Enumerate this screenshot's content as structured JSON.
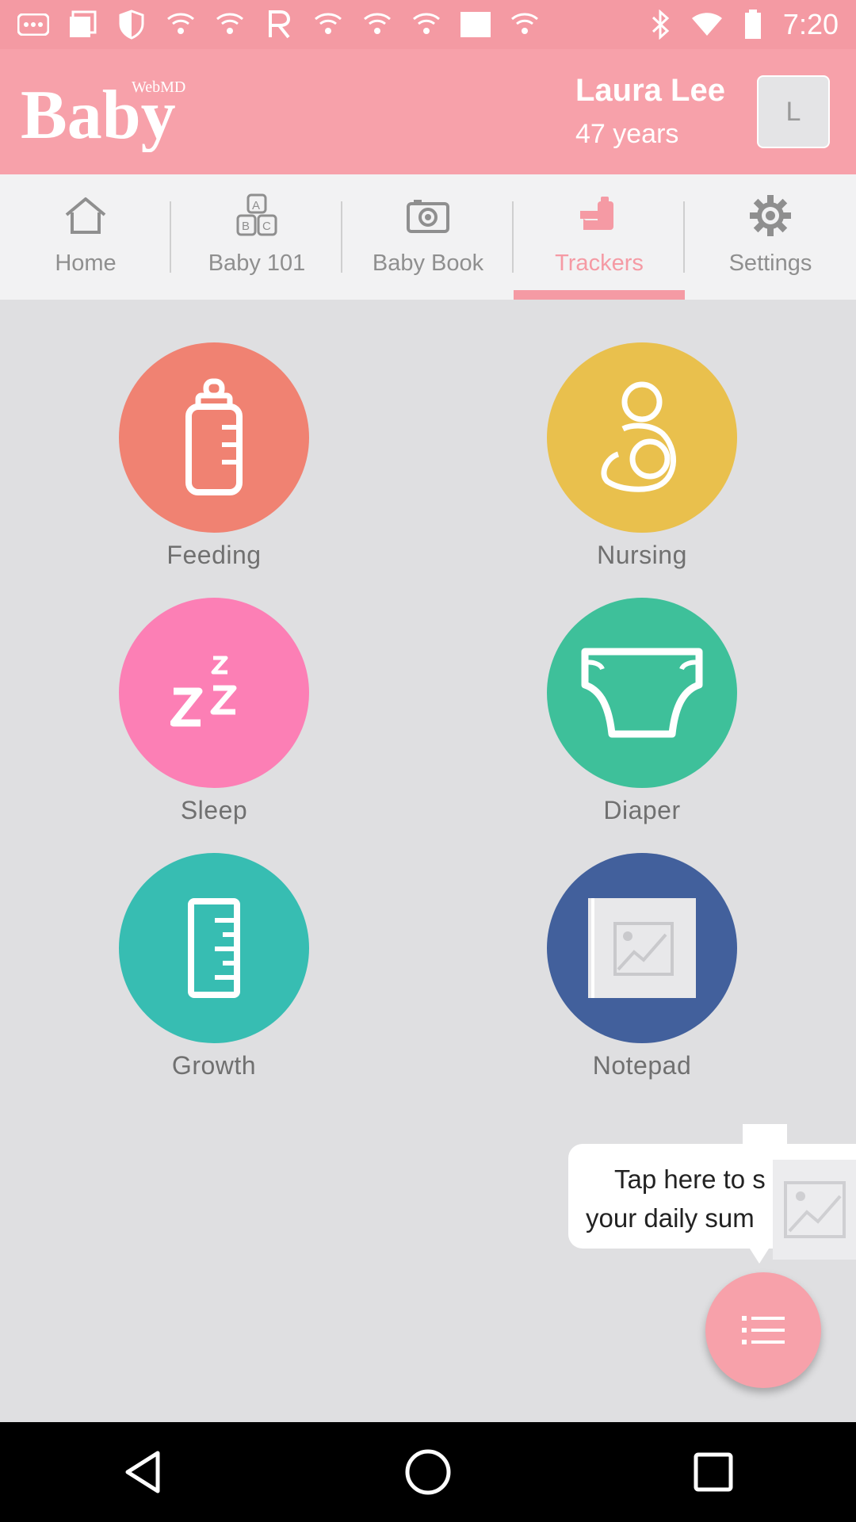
{
  "status_bar": {
    "time": "7:20",
    "icons": [
      "more-icon",
      "gallery-icon",
      "shield-icon",
      "wifi-icon",
      "wifi-icon",
      "app-r-icon",
      "wifi-icon",
      "wifi-icon",
      "wifi-icon",
      "image-icon",
      "wifi-icon",
      "bluetooth-icon",
      "wifi-icon",
      "battery-icon"
    ]
  },
  "header": {
    "logo_main": "Baby",
    "logo_brand": "WebMD",
    "user_name": "Laura Lee",
    "user_age": "47 years",
    "avatar_initial": "L"
  },
  "tabs": [
    {
      "label": "Home",
      "icon": "home-icon"
    },
    {
      "label": "Baby 101",
      "icon": "abc-blocks-icon"
    },
    {
      "label": "Baby Book",
      "icon": "camera-icon"
    },
    {
      "label": "Trackers",
      "icon": "tracker-icon",
      "active": true
    },
    {
      "label": "Settings",
      "icon": "gear-icon"
    }
  ],
  "trackers": [
    {
      "label": "Feeding",
      "color": "#f08272",
      "icon": "bottle-icon"
    },
    {
      "label": "Nursing",
      "color": "#e9c04d",
      "icon": "nursing-icon"
    },
    {
      "label": "Sleep",
      "color": "#fc7fb5",
      "icon": "zzz-icon"
    },
    {
      "label": "Diaper",
      "color": "#3ec09a",
      "icon": "diaper-icon"
    },
    {
      "label": "Growth",
      "color": "#37bdb2",
      "icon": "ruler-icon"
    },
    {
      "label": "Notepad",
      "color": "#42609c",
      "icon": "image-icon"
    }
  ],
  "tooltip": {
    "line1": "Tap here to s",
    "line2": "your daily sum"
  },
  "colors": {
    "brand_pink": "#f7a1aa",
    "background": "#dfdfe1"
  }
}
